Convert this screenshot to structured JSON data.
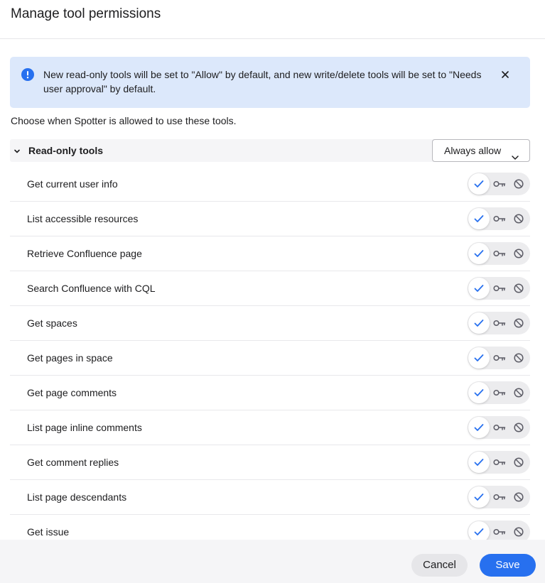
{
  "dialog": {
    "title": "Manage tool permissions"
  },
  "banner": {
    "text": "New read-only tools will be set to \"Allow\" by default, and new write/delete tools will be set to \"Needs user approval\" by default.",
    "icon": "info-icon",
    "close_icon": "close-icon",
    "color": "#dce8fb",
    "icon_color": "#2770ef"
  },
  "subtitle": "Choose when Spotter is allowed to use these tools.",
  "group": {
    "label": "Read-only tools",
    "expanded": true,
    "dropdown_value": "Always allow"
  },
  "tools": [
    {
      "name": "Get current user info",
      "selected": "allow"
    },
    {
      "name": "List accessible resources",
      "selected": "allow"
    },
    {
      "name": "Retrieve Confluence page",
      "selected": "allow"
    },
    {
      "name": "Search Confluence with CQL",
      "selected": "allow"
    },
    {
      "name": "Get spaces",
      "selected": "allow"
    },
    {
      "name": "Get pages in space",
      "selected": "allow"
    },
    {
      "name": "Get page comments",
      "selected": "allow"
    },
    {
      "name": "List page inline comments",
      "selected": "allow"
    },
    {
      "name": "Get comment replies",
      "selected": "allow"
    },
    {
      "name": "List page descendants",
      "selected": "allow"
    },
    {
      "name": "Get issue",
      "selected": "allow"
    }
  ],
  "footer": {
    "cancel_label": "Cancel",
    "save_label": "Save",
    "accent_color": "#2770ef"
  }
}
